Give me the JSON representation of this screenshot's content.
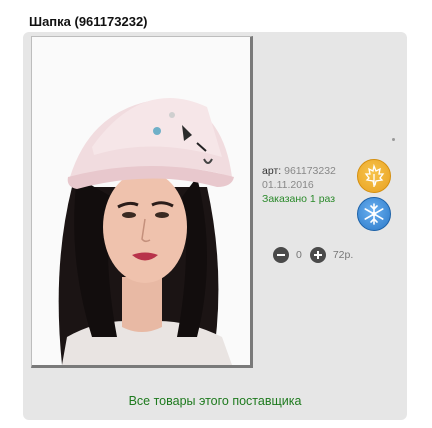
{
  "product": {
    "title": "Шапка (961173232)",
    "article_label": "арт:",
    "article_value": "961173232",
    "date": "01.11.2016",
    "ordered_text": "Заказано 1 раз"
  },
  "seasons": [
    {
      "name": "autumn",
      "icon": "maple-leaf-icon",
      "color": "#F2B130"
    },
    {
      "name": "winter",
      "icon": "snowflake-icon",
      "color": "#3A8AD8"
    }
  ],
  "cart": {
    "quantity": "0",
    "price": "72р."
  },
  "links": {
    "supplier_all": "Все товары этого поставщика"
  },
  "colors": {
    "link_green": "#1E7A1E",
    "card_bg": "#E6E6E6"
  }
}
